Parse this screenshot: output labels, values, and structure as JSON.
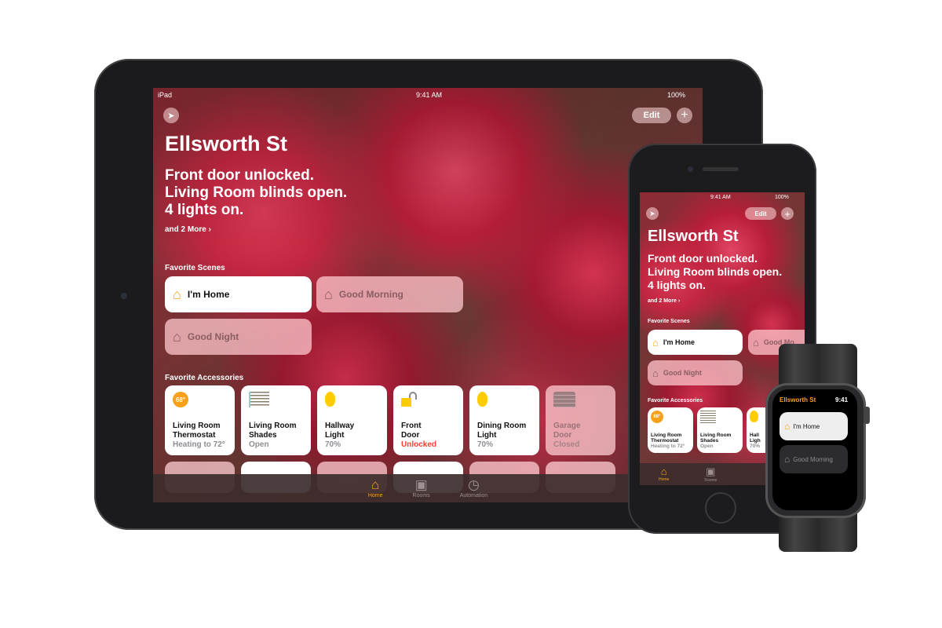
{
  "ipad": {
    "status": {
      "carrier": "iPad",
      "time": "9:41 AM",
      "battery": "100%"
    },
    "edit_label": "Edit",
    "add_icon": "plus-icon",
    "location_icon": "location-arrow-icon",
    "home_name": "Ellsworth St",
    "summary": [
      "Front door unlocked.",
      "Living Room blinds open.",
      "4 lights on."
    ],
    "more_link": "and 2 More ›",
    "scenes_title": "Favorite Scenes",
    "scenes": [
      {
        "label": "I'm Home",
        "active": true
      },
      {
        "label": "Good Morning",
        "active": false
      },
      {
        "label": "Good Night",
        "active": false
      }
    ],
    "accessories_title": "Favorite Accessories",
    "accessories": [
      {
        "name1": "Living Room",
        "name2": "Thermostat",
        "status": "Heating to 72°",
        "badge": "68°",
        "icon": "thermostat-icon",
        "active": true
      },
      {
        "name1": "Living Room",
        "name2": "Shades",
        "status": "Open",
        "icon": "shades-icon",
        "active": true
      },
      {
        "name1": "Hallway",
        "name2": "Light",
        "status": "70%",
        "icon": "lightbulb-icon",
        "active": true
      },
      {
        "name1": "Front",
        "name2": "Door",
        "status": "Unlocked",
        "icon": "unlocked-lock-icon",
        "active": true,
        "status_color": "#ff3b30"
      },
      {
        "name1": "Dining Room",
        "name2": "Light",
        "status": "70%",
        "icon": "lightbulb-icon",
        "active": true
      },
      {
        "name1": "Garage",
        "name2": "Door",
        "status": "Closed",
        "icon": "garage-door-icon",
        "active": false
      }
    ],
    "tabs": [
      {
        "label": "Home",
        "active": true
      },
      {
        "label": "Rooms",
        "active": false
      },
      {
        "label": "Automation",
        "active": false
      }
    ]
  },
  "iphone": {
    "status": {
      "time": "9:41 AM",
      "battery": "100%"
    },
    "edit_label": "Edit",
    "home_name": "Ellsworth St",
    "summary": [
      "Front door unlocked.",
      "Living Room blinds open.",
      "4 lights on."
    ],
    "more_link": "and 2 More ›",
    "scenes_title": "Favorite Scenes",
    "scenes": [
      {
        "label": "I'm Home"
      },
      {
        "label": "Good Mo"
      },
      {
        "label": "Good Night"
      }
    ],
    "accessories_title": "Favorite Accessories",
    "accessories": [
      {
        "name1": "Living Room",
        "name2": "Thermostat",
        "status": "Heating to 72°",
        "badge": "68°"
      },
      {
        "name1": "Living Room",
        "name2": "Shades",
        "status": "Open"
      },
      {
        "name1": "Hall",
        "name2": "Ligh",
        "status": "70%"
      }
    ],
    "tabs": [
      {
        "label": "Home"
      },
      {
        "label": "Rooms"
      }
    ]
  },
  "watch": {
    "title": "Ellsworth St",
    "time": "9:41",
    "scenes": [
      {
        "label": "I'm Home"
      },
      {
        "label": "Good Morning"
      }
    ]
  },
  "colors": {
    "accent": "#f7a11a",
    "unlocked": "#ff3b30",
    "bulb": "#ffcc00"
  }
}
